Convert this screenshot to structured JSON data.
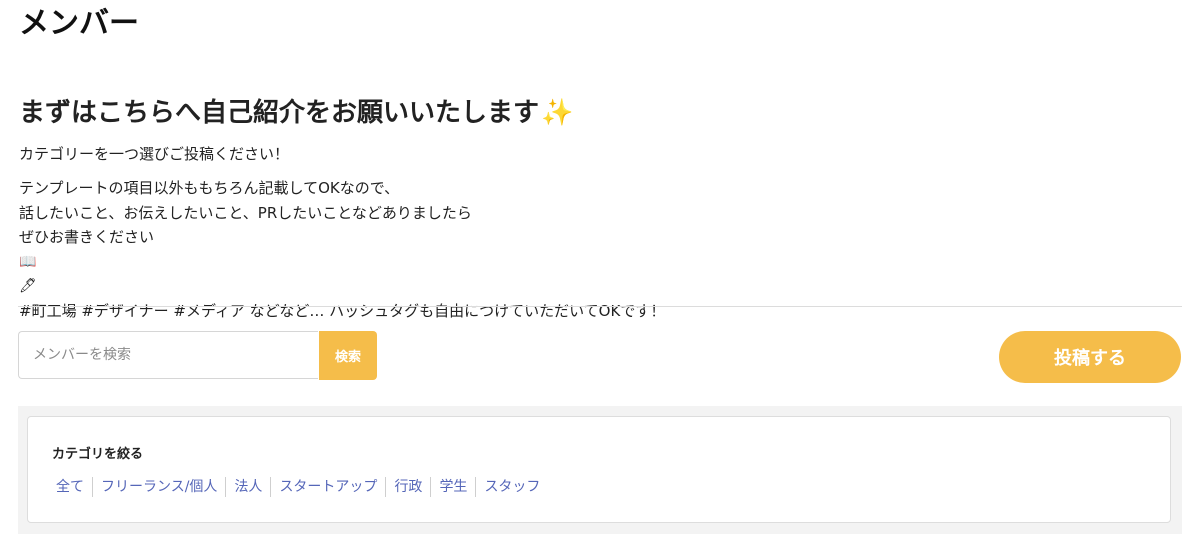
{
  "header": {
    "title": "メンバー"
  },
  "intro": {
    "heading": "まずはこちらへ自己紹介をお願いいたします",
    "heading_icon": "✨",
    "lead": "カテゴリーを一つ選びご投稿ください！",
    "lines": [
      "テンプレートの項目以外ももちろん記載してOKなので、",
      "話したいこと、お伝えしたいこと、PRしたいことなどありましたら",
      "ぜひお書きください",
      "#町工場 #デザイナー #メディア などなど… ハッシュタグも自由につけていただいてOKです！"
    ],
    "book_icon": "📖",
    "pen_icon": "🖊"
  },
  "search": {
    "placeholder": "メンバーを検索",
    "value": "",
    "button_label": "検索"
  },
  "post": {
    "button_label": "投稿する"
  },
  "filter": {
    "title": "カテゴリを絞る",
    "categories": [
      "全て",
      "フリーランス/個人",
      "法人",
      "スタートアップ",
      "行政",
      "学生",
      "スタッフ"
    ]
  },
  "colors": {
    "accent": "#f5bd4a",
    "link": "#5566b8",
    "divider": "#dcdcdc",
    "filter_bg": "#f3f3f3"
  }
}
